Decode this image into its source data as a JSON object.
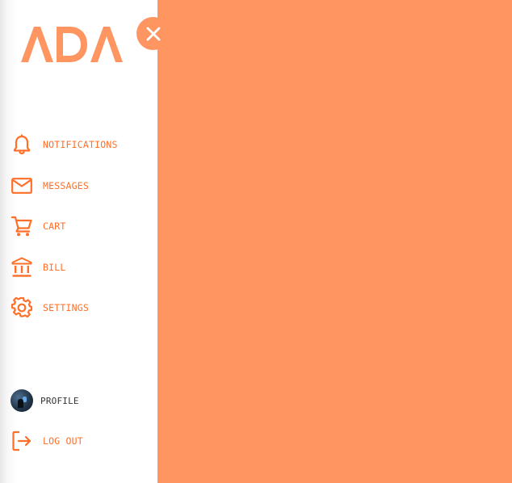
{
  "brand": {
    "logo_text": "ADA"
  },
  "colors": {
    "accent": "#ff6f28",
    "panel_bg": "#ff9661",
    "sidebar_bg": "#ffffff"
  },
  "sidebar": {
    "close_icon": "close-icon",
    "items": [
      {
        "label": "NOTIFICATIONS",
        "icon": "bell-icon"
      },
      {
        "label": "MESSAGES",
        "icon": "envelope-icon"
      },
      {
        "label": "CART",
        "icon": "cart-icon"
      },
      {
        "label": "BILL",
        "icon": "bank-icon"
      },
      {
        "label": "SETTINGS",
        "icon": "gear-icon"
      }
    ],
    "profile": {
      "label": "PROFILE"
    },
    "logout": {
      "label": "LOG OUT",
      "icon": "logout-icon"
    }
  }
}
